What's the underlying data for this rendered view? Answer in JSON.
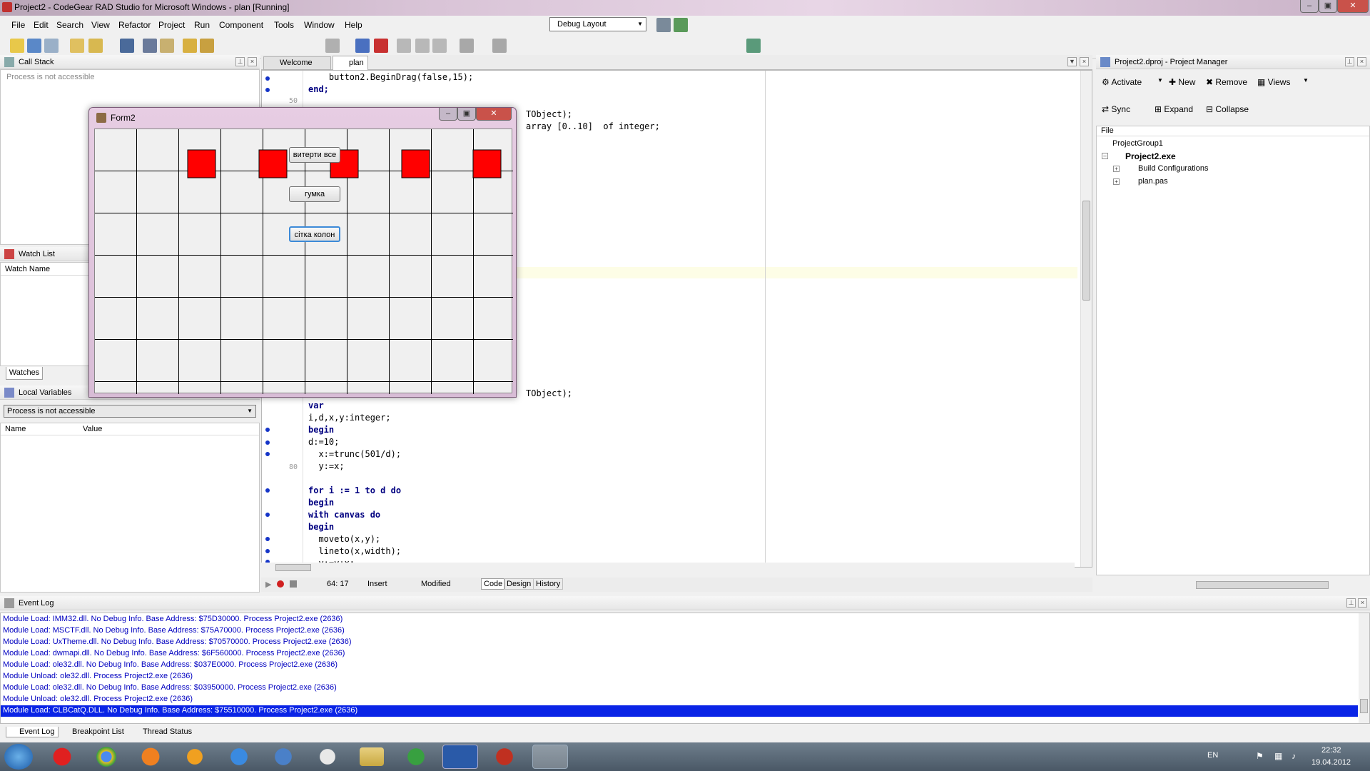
{
  "window": {
    "title": "Project2 - CodeGear RAD Studio for Microsoft Windows - plan [Running]"
  },
  "menu": [
    "File",
    "Edit",
    "Search",
    "View",
    "Refactor",
    "Project",
    "Run",
    "Component",
    "Tools",
    "Window",
    "Help"
  ],
  "layout_combo": {
    "value": "Debug Layout"
  },
  "call_stack": {
    "title": "Call Stack",
    "status": "Process is not accessible"
  },
  "watch_list": {
    "title": "Watch List",
    "col": "Watch Name",
    "tab": "Watches"
  },
  "local_vars": {
    "title": "Local Variables",
    "combo": "Process is not accessible",
    "col_name": "Name",
    "col_value": "Value"
  },
  "editor": {
    "tabs": [
      "Welcome Page",
      "plan"
    ],
    "status": {
      "pos": "64: 17",
      "mode": "Insert",
      "state": "Modified"
    },
    "view_tabs": [
      "Code",
      "Design",
      "History"
    ],
    "line_numbers": [
      "50",
      "80"
    ],
    "code_top": [
      "    button2.BeginDrag(false,15);",
      "end;"
    ],
    "code_frag1": "TObject);",
    "code_frag2": "array [0..10]  of integer;",
    "code_frag3": "TObject);",
    "code_bottom": [
      "var",
      "i,d,x,y:integer;",
      "begin",
      "d:=10;",
      "  x:=trunc(501/d);",
      "  y:=x;",
      "",
      "for i := 1 to d do",
      "begin",
      "with canvas do",
      "begin",
      "  moveto(x,y);",
      "  lineto(x,width);",
      "  y:=y+x;"
    ]
  },
  "form2": {
    "title": "Form2",
    "buttons": [
      "витерти все",
      "гумка",
      "сітка колон"
    ]
  },
  "project_manager": {
    "title": "Project2.dproj - Project Manager",
    "buttons": [
      "Activate",
      "New",
      "Remove",
      "Views",
      "Sync",
      "Expand",
      "Collapse"
    ],
    "col": "File",
    "tree": [
      "ProjectGroup1",
      "Project2.exe",
      "Build Configurations",
      "plan.pas"
    ]
  },
  "event_log": {
    "title": "Event Log",
    "lines": [
      "Module Load: IMM32.dll. No Debug Info. Base Address: $75D30000. Process Project2.exe (2636)",
      "Module Load: MSCTF.dll. No Debug Info. Base Address: $75A70000. Process Project2.exe (2636)",
      "Module Load: UxTheme.dll. No Debug Info. Base Address: $70570000. Process Project2.exe (2636)",
      "Module Load: dwmapi.dll. No Debug Info. Base Address: $6F560000. Process Project2.exe (2636)",
      "Module Load: ole32.dll. No Debug Info. Base Address: $037E0000. Process Project2.exe (2636)",
      "Module Unload: ole32.dll. Process Project2.exe (2636)",
      "Module Load: ole32.dll. No Debug Info. Base Address: $03950000. Process Project2.exe (2636)",
      "Module Unload: ole32.dll. Process Project2.exe (2636)",
      "Module Load: CLBCatQ.DLL. No Debug Info. Base Address: $75510000. Process Project2.exe (2636)"
    ],
    "tabs": [
      "Event Log",
      "Breakpoint List",
      "Thread Status"
    ]
  },
  "tray": {
    "lang": "EN",
    "time": "22:32",
    "date": "19.04.2012"
  },
  "colors": {
    "selection": "#0a24e6",
    "red": "#ff0000",
    "code_kw": "#000080",
    "number": "#1a3ad0"
  }
}
